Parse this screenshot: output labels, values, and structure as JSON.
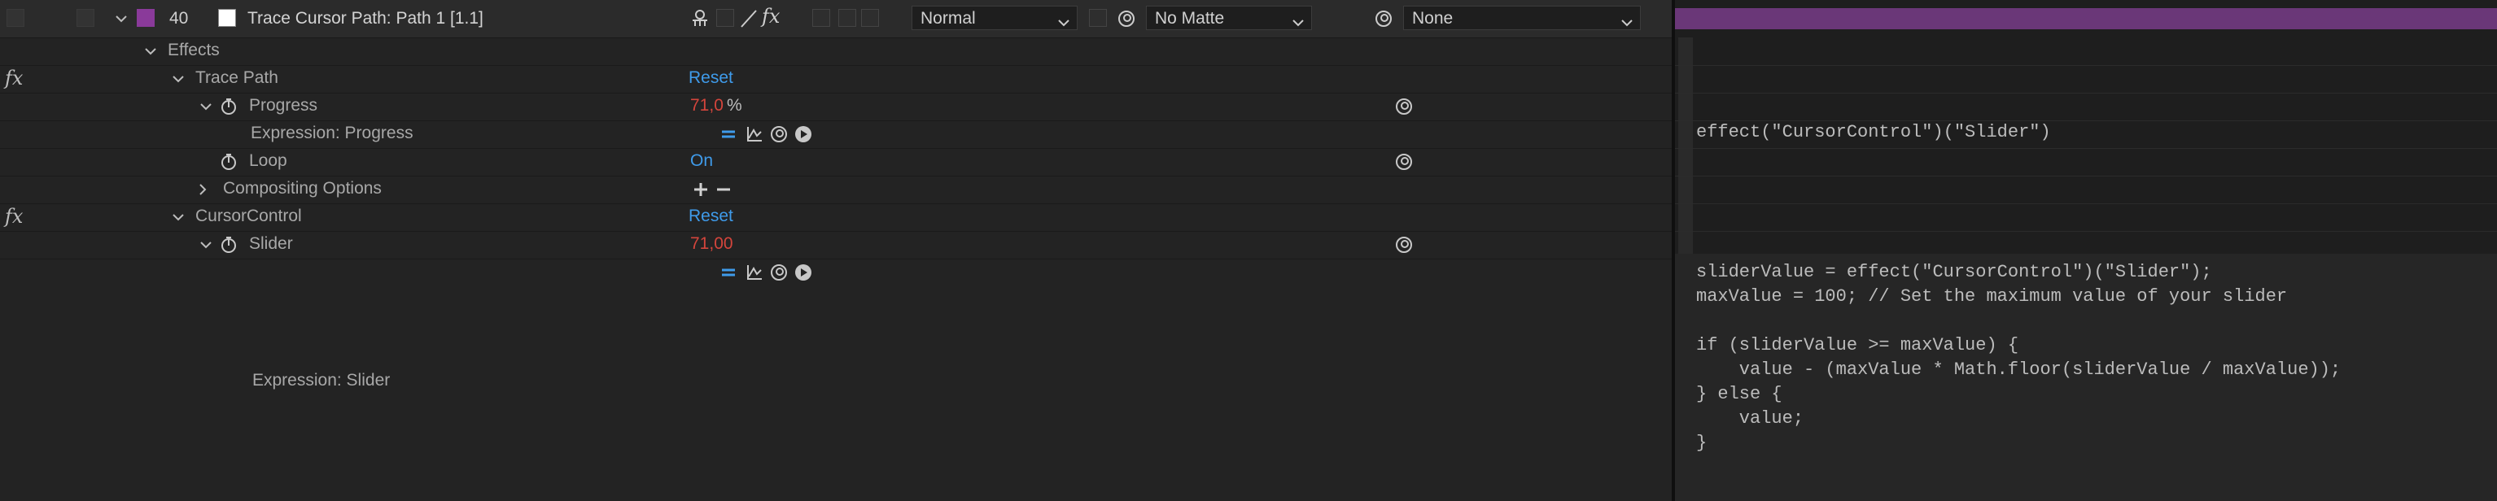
{
  "layer": {
    "number": "40",
    "name": "Trace Cursor Path: Path 1 [1.1]",
    "label_color": "#8a3a9a",
    "mode": "Normal",
    "track_matte": "No Matte",
    "parent": "None"
  },
  "rows": {
    "effects": "Effects",
    "trace_path": {
      "name": "Trace Path",
      "reset": "Reset"
    },
    "progress": {
      "name": "Progress",
      "value": "71,0",
      "unit": "%"
    },
    "expr_progress": "Expression: Progress",
    "loop": {
      "name": "Loop",
      "value": "On"
    },
    "compositing": "Compositing Options",
    "cursor_control": {
      "name": "CursorControl",
      "reset": "Reset"
    },
    "slider": {
      "name": "Slider",
      "value": "71,00"
    },
    "expr_slider": "Expression: Slider"
  },
  "fx_label": "fx",
  "expressions": {
    "progress": "effect(\"CursorControl\")(\"Slider\")",
    "slider_lines": [
      "sliderValue = effect(\"CursorControl\")(\"Slider\");",
      "maxValue = 100; // Set the maximum value of your slider",
      "",
      "if (sliderValue >= maxValue) {",
      "    value - (maxValue * Math.floor(sliderValue / maxValue));",
      "} else {",
      "    value;",
      "}"
    ]
  },
  "colors": {
    "value_red": "#d4453c",
    "value_blue": "#3f9bea",
    "label_purple": "#8a3a9a"
  }
}
